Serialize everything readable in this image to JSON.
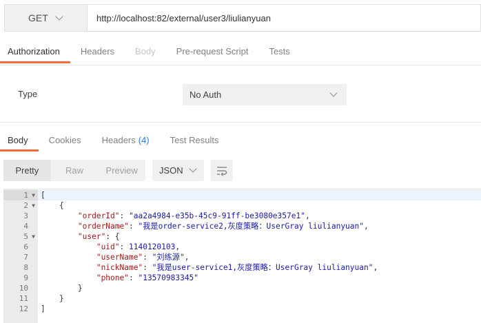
{
  "request": {
    "method": "GET",
    "url": "http://localhost:82/external/user3/liulianyuan"
  },
  "request_tabs": [
    {
      "label": "Authorization",
      "active": true
    },
    {
      "label": "Headers"
    },
    {
      "label": "Body",
      "disabled": true
    },
    {
      "label": "Pre-request Script"
    },
    {
      "label": "Tests"
    }
  ],
  "auth": {
    "type_label": "Type",
    "type_value": "No Auth"
  },
  "response_tabs": {
    "body": "Body",
    "cookies": "Cookies",
    "headers": "Headers",
    "headers_count": "(4)",
    "test_results": "Test Results"
  },
  "toolbar": {
    "pretty": "Pretty",
    "raw": "Raw",
    "preview": "Preview",
    "format": "JSON"
  },
  "code_lines": [
    {
      "n": "1",
      "fold": true,
      "active": true,
      "html": "<span class='p'>[</span>"
    },
    {
      "n": "2",
      "fold": true,
      "html": "    <span class='p'>{</span>"
    },
    {
      "n": "3",
      "html": "        <span class='k'>\"orderId\"</span><span class='p'>: </span><span class='s'>\"aa2a4984-e35b-45c9-91ff-be3080e357e1\"</span><span class='p'>,</span>"
    },
    {
      "n": "4",
      "html": "        <span class='k'>\"orderName\"</span><span class='p'>: </span><span class='s'>\"我是order-service2,灰度策略：UserGray liulianyuan\"</span><span class='p'>,</span>"
    },
    {
      "n": "5",
      "fold": true,
      "html": "        <span class='k'>\"user\"</span><span class='p'>: {</span>"
    },
    {
      "n": "6",
      "html": "            <span class='k'>\"uid\"</span><span class='p'>: </span><span class='n'>1140120103</span><span class='p'>,</span>"
    },
    {
      "n": "7",
      "html": "            <span class='k'>\"userName\"</span><span class='p'>: </span><span class='s'>\"刘练源\"</span><span class='p'>,</span>"
    },
    {
      "n": "8",
      "html": "            <span class='k'>\"nickName\"</span><span class='p'>: </span><span class='s'>\"我是user-service1,灰度策略：UserGray liulianyuan\"</span><span class='p'>,</span>"
    },
    {
      "n": "9",
      "html": "            <span class='k'>\"phone\"</span><span class='p'>: </span><span class='s'>\"13570983345\"</span>"
    },
    {
      "n": "10",
      "html": "        <span class='p'>}</span>"
    },
    {
      "n": "11",
      "html": "    <span class='p'>}</span>"
    },
    {
      "n": "12",
      "html": "<span class='p'>]</span>"
    }
  ],
  "colors": {
    "accent": "#f26b3a",
    "count": "#2f7bd8",
    "json_key": "#a11a1a",
    "json_string": "#1a1aa6"
  },
  "icons": {
    "method_dropdown": "chevron-down-icon",
    "auth_dropdown": "chevron-down-icon",
    "format_dropdown": "chevron-down-icon",
    "wrap": "wrap-lines-icon",
    "fold": "fold-arrow-icon"
  }
}
